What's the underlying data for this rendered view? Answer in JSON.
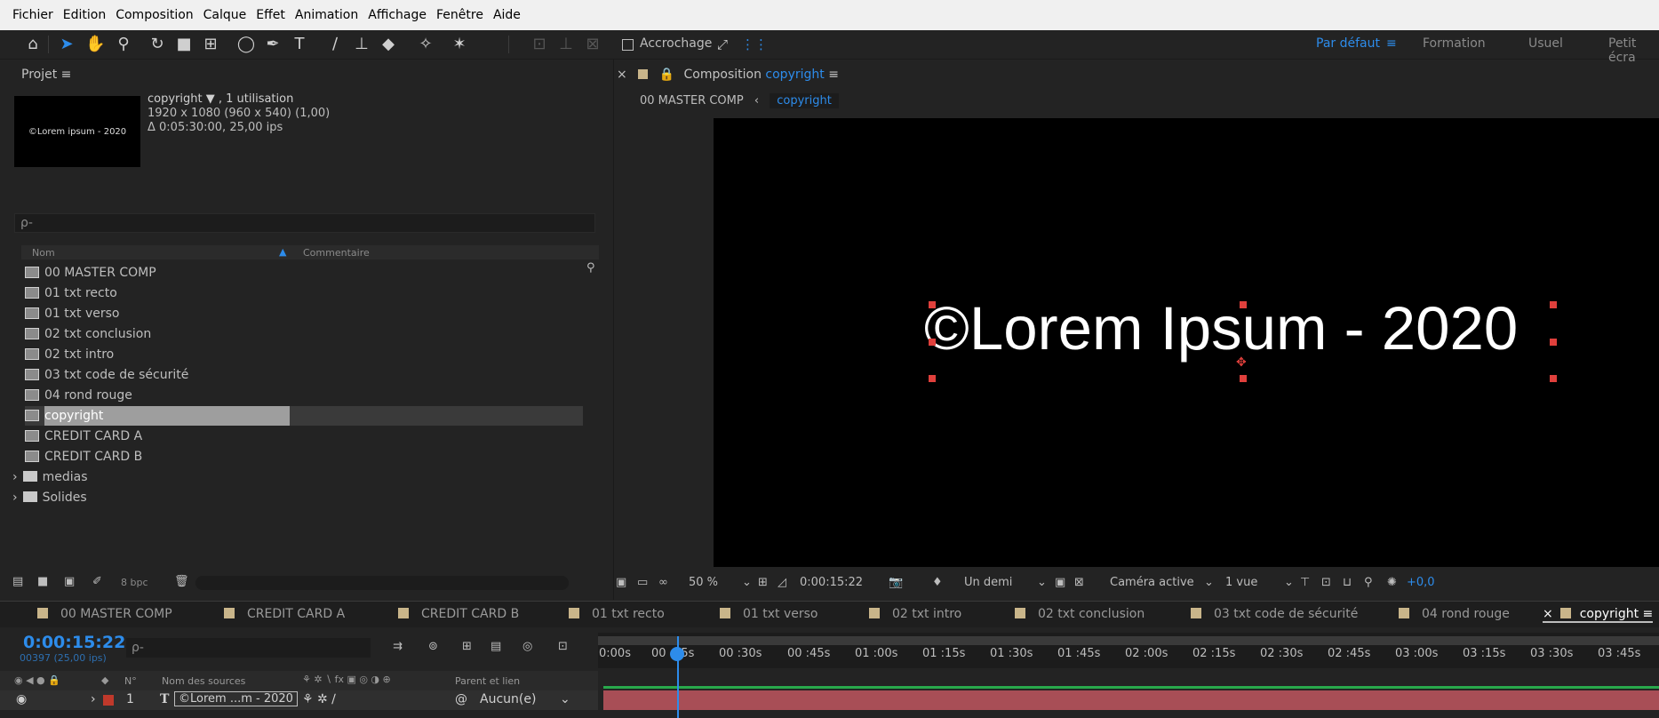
{
  "menu": [
    "Fichier",
    "Edition",
    "Composition",
    "Calque",
    "Effet",
    "Animation",
    "Affichage",
    "Fenêtre",
    "Aide"
  ],
  "toolbar": {
    "snap_label": "Accrochage",
    "workspaces": [
      "Par défaut",
      "Formation",
      "Usuel",
      "Petit écra"
    ],
    "active_workspace": "Par défaut"
  },
  "project": {
    "title": "Projet",
    "thumb_text": "©Lorem ipsum - 2020",
    "comp_name": "copyright ▼ , 1 utilisation",
    "size": "1920 x 1080  (960 x 540) (1,00)",
    "duration": "Δ 0:05:30:00, 25,00 ips",
    "search_placeholder": "ρ-",
    "col_name": "Nom",
    "col_comment": "Commentaire",
    "items": [
      {
        "label": "00 MASTER COMP",
        "type": "comp"
      },
      {
        "label": "01 txt recto",
        "type": "comp"
      },
      {
        "label": "01 txt verso",
        "type": "comp"
      },
      {
        "label": "02 txt conclusion",
        "type": "comp"
      },
      {
        "label": "02 txt intro",
        "type": "comp"
      },
      {
        "label": "03 txt code de sécurité",
        "type": "comp"
      },
      {
        "label": "04 rond rouge",
        "type": "comp"
      },
      {
        "label": "copyright",
        "type": "comp",
        "selected": true
      },
      {
        "label": "CREDIT CARD A",
        "type": "comp"
      },
      {
        "label": "CREDIT CARD B",
        "type": "comp"
      },
      {
        "label": "medias",
        "type": "folder"
      },
      {
        "label": "Solides",
        "type": "folder"
      }
    ],
    "bpc": "8 bpc"
  },
  "comp": {
    "tab_prefix": "Composition",
    "tab_name": "copyright",
    "breadcrumb_parent": "00 MASTER COMP",
    "breadcrumb_current": "copyright",
    "canvas_text": "©Lorem Ipsum - 2020",
    "zoom": "50 %",
    "timecode": "0:00:15:22",
    "resolution": "Un demi",
    "camera": "Caméra active",
    "views": "1 vue",
    "exposure": "+0,0"
  },
  "timeline": {
    "tabs": [
      "00 MASTER COMP",
      "CREDIT CARD A",
      "CREDIT CARD B",
      "01 txt recto",
      "01 txt verso",
      "02 txt intro",
      "02 txt conclusion",
      "03 txt code de sécurité",
      "04 rond rouge",
      "copyright"
    ],
    "active_tab": "copyright",
    "timecode": "0:00:15:22",
    "fps": "00397 (25,00 ips)",
    "search_placeholder": "ρ-",
    "ticks": [
      "0:00s",
      "00 :15s",
      "00 :30s",
      "00 :45s",
      "01 :00s",
      "01 :15s",
      "01 :30s",
      "01 :45s",
      "02 :00s",
      "02 :15s",
      "02 :30s",
      "02 :45s",
      "03 :00s",
      "03 :15s",
      "03 :30s",
      "03 :45s"
    ],
    "col_no": "N°",
    "col_source": "Nom des sources",
    "col_parent": "Parent et lien",
    "layer_number": "1",
    "layer_name": "©Lorem ...m - 2020",
    "layer_parent": "Aucun(e)"
  },
  "colors": {
    "accent": "#2d8ceb",
    "label_tan": "#c9b58a",
    "layer_red": "#a84e56",
    "track_green": "#28a84b"
  }
}
